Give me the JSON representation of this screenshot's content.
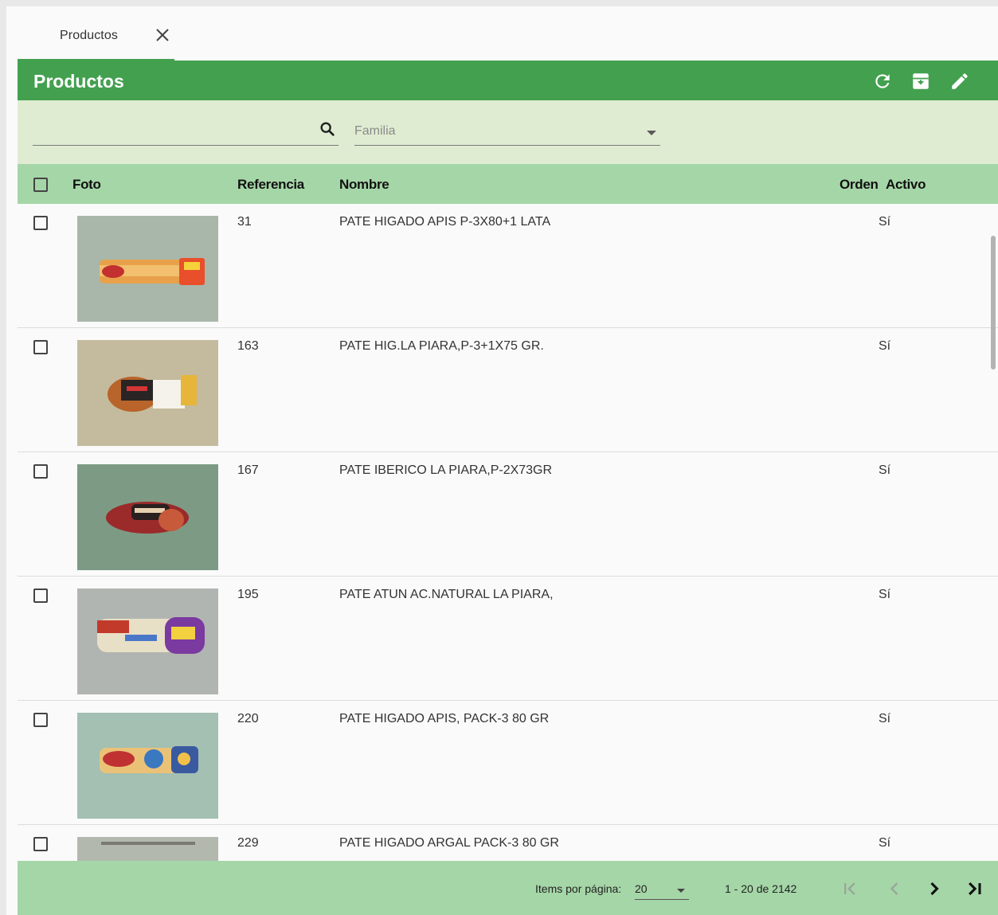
{
  "tab": {
    "label": "Productos",
    "close_icon": "close-icon"
  },
  "header": {
    "title": "Productos",
    "actions": [
      "refresh-icon",
      "archive-icon",
      "edit-icon"
    ]
  },
  "filters": {
    "search_value": "",
    "search_icon": "search-icon",
    "familia_placeholder": "Familia"
  },
  "table": {
    "columns": {
      "foto": "Foto",
      "referencia": "Referencia",
      "nombre": "Nombre",
      "orden": "Orden",
      "activo": "Activo"
    },
    "rows": [
      {
        "referencia": "31",
        "nombre": "PATE HIGADO APIS P-3X80+1 LATA",
        "orden": "",
        "activo": "Sí"
      },
      {
        "referencia": "163",
        "nombre": "PATE HIG.LA PIARA,P-3+1X75 GR.",
        "orden": "",
        "activo": "Sí"
      },
      {
        "referencia": "167",
        "nombre": "PATE IBERICO LA PIARA,P-2X73GR",
        "orden": "",
        "activo": "Sí"
      },
      {
        "referencia": "195",
        "nombre": "PATE ATUN AC.NATURAL LA PIARA,",
        "orden": "",
        "activo": "Sí"
      },
      {
        "referencia": "220",
        "nombre": "PATE HIGADO APIS, PACK-3 80 GR",
        "orden": "",
        "activo": "Sí"
      },
      {
        "referencia": "229",
        "nombre": "PATE HIGADO ARGAL PACK-3 80 GR",
        "orden": "",
        "activo": "Sí"
      }
    ]
  },
  "paginator": {
    "items_label": "Items por página:",
    "page_size": "20",
    "range": "1 - 20 de 2142"
  },
  "colors": {
    "primary": "#43a04f",
    "header_row": "#a5d6a7",
    "filter_band": "#e0ecd2"
  }
}
